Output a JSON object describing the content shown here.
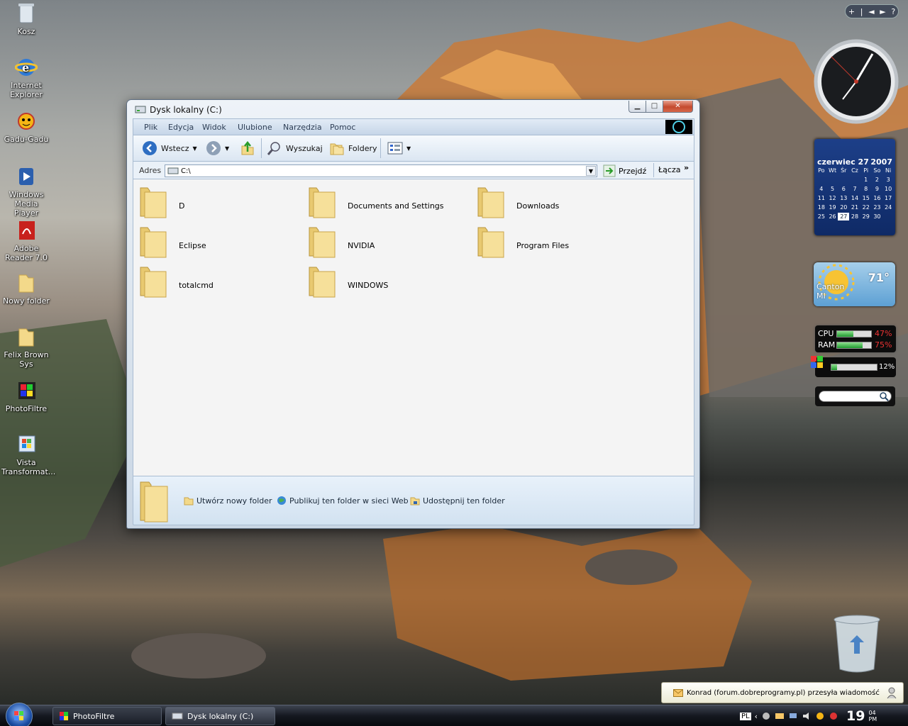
{
  "desktop": {
    "icons": [
      {
        "label": "Kosz",
        "icon": "recycle-bin-icon"
      },
      {
        "label": "Internet Explorer",
        "icon": "internet-explorer-icon"
      },
      {
        "label": "Gadu-Gadu",
        "icon": "gadu-gadu-icon"
      },
      {
        "label": "Windows Media Player",
        "icon": "media-player-icon"
      },
      {
        "label": "Adobe Reader 7.0",
        "icon": "adobe-reader-icon"
      },
      {
        "label": "Nowy folder",
        "icon": "folder-icon"
      },
      {
        "label": "Felix Brown Sys",
        "icon": "folder-icon"
      },
      {
        "label": "PhotoFiltre",
        "icon": "photofiltre-icon"
      },
      {
        "label": "Vista Transformat...",
        "icon": "vista-transformation-icon"
      }
    ]
  },
  "window": {
    "title": "Dysk lokalny (C:)",
    "menu": [
      "Plik",
      "Edycja",
      "Widok",
      "Ulubione",
      "Narzędzia",
      "Pomoc"
    ],
    "toolbar": {
      "back": "Wstecz",
      "search": "Wyszukaj",
      "folders": "Foldery"
    },
    "address": {
      "label": "Adres",
      "value": "C:\\",
      "go": "Przejdź",
      "links": "Łącza"
    },
    "folders": [
      "D",
      "Documents and Settings",
      "Downloads",
      "Eclipse",
      "NVIDIA",
      "Program Files",
      "totalcmd",
      "WINDOWS"
    ],
    "tasks": [
      "Utwórz nowy folder",
      "Publikuj ten folder w sieci Web",
      "Udostępnij ten folder"
    ]
  },
  "gadgets": {
    "calendar": {
      "month": "czerwiec 27",
      "year": "2007",
      "days_header": [
        "Po",
        "Wt",
        "Śr",
        "Cz",
        "Pi",
        "So",
        "Ni"
      ],
      "weeks": [
        [
          "",
          "",
          "",
          "",
          "1",
          "2",
          "3"
        ],
        [
          "4",
          "5",
          "6",
          "7",
          "8",
          "9",
          "10"
        ],
        [
          "11",
          "12",
          "13",
          "14",
          "15",
          "16",
          "17"
        ],
        [
          "18",
          "19",
          "20",
          "21",
          "22",
          "23",
          "24"
        ],
        [
          "25",
          "26",
          "27",
          "28",
          "29",
          "30",
          ""
        ]
      ],
      "selected": "27"
    },
    "weather": {
      "city": "Canton",
      "state": "MI",
      "temp": "71°"
    },
    "meter": {
      "cpu_label": "CPU",
      "cpu_value": "47%",
      "cpu_level": 0.47,
      "ram_label": "RAM",
      "ram_value": "75%",
      "ram_level": 0.75
    },
    "disk": {
      "value": "12%",
      "level": 0.12
    }
  },
  "sidebar_controls": [
    "+",
    "|",
    "◄",
    "►",
    "?"
  ],
  "notification": {
    "text": "Konrad (forum.dobreprogramy.pl) przesyła wiadomość"
  },
  "taskbar": {
    "buttons": [
      "PhotoFiltre",
      "Dysk lokalny (C:)"
    ],
    "lang": "PL",
    "time": "19",
    "time_small": "04 PM"
  },
  "colors": {
    "accent": "#1f4e9b",
    "window_bg": "#f4f4f4",
    "taskbar": "#151820"
  }
}
